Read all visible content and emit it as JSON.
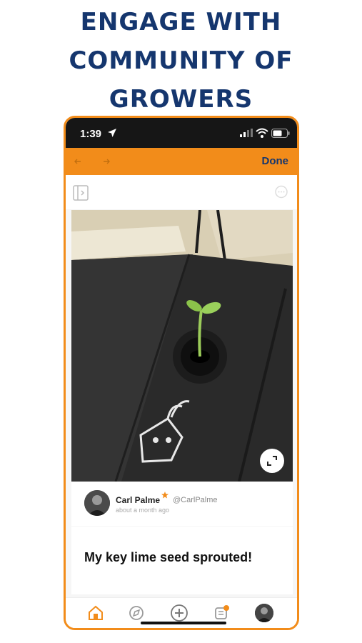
{
  "headline": {
    "line1": "ENGAGE WITH",
    "line2": "COMMUNITY OF",
    "line3": "GROWERS"
  },
  "status_bar": {
    "time": "1:39",
    "icons": [
      "location-arrow-icon",
      "signal-icon",
      "wifi-icon",
      "battery-icon"
    ]
  },
  "nav": {
    "done_label": "Done",
    "icons": [
      "back-arrow-icon",
      "forward-arrow-icon"
    ]
  },
  "toolbar": {
    "icons": [
      "sidebar-toggle-icon",
      "chat-icon"
    ]
  },
  "post": {
    "image_icon": "expand-icon",
    "author_name": "Carl Palme",
    "author_handle": "@CarlPalme",
    "time_ago": "about a month ago",
    "text": "My key lime seed sprouted!"
  },
  "tabbar": {
    "items": [
      "home-icon",
      "explore-icon",
      "add-icon",
      "feed-icon",
      "profile-avatar"
    ]
  },
  "colors": {
    "accent": "#f28c1a",
    "headline": "#15366e",
    "status_bar": "#161616"
  }
}
